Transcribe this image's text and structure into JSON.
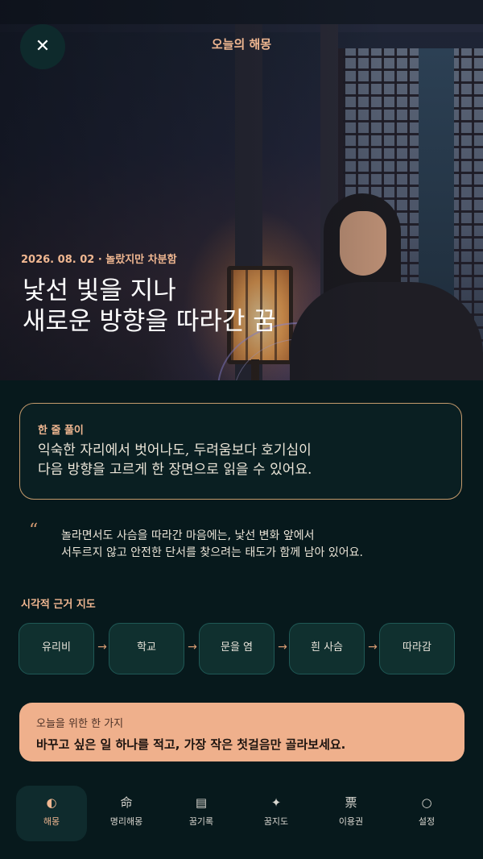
{
  "header": {
    "title": "오늘의 해몽",
    "close_label": "✕"
  },
  "hero": {
    "meta": "2026. 08. 02 · 놀랐지만 차분함",
    "title_lines": [
      "낯선 빛을 지나",
      "새로운 방향을 따라간 꿈"
    ]
  },
  "summary": {
    "label": "한 줄 풀이",
    "lines": [
      "익숙한 자리에서 벗어나도, 두려움보다 호기심이",
      "다음 방향을 고르게 한 장면으로 읽을 수 있어요."
    ]
  },
  "quote": {
    "mark": "“",
    "lines": [
      "놀라면서도 사슴을 따라간 마음에는, 낯선 변화 앞에서",
      "서두르지 않고 안전한 단서를 찾으려는 태도가 함께 남아 있어요."
    ]
  },
  "visual_map": {
    "title": "시각적 근거 지도",
    "nodes": [
      "유리비",
      "학교",
      "문을 염",
      "흰 사슴",
      "따라감"
    ],
    "arrow": "→"
  },
  "action": {
    "label": "오늘을 위한 한 가지",
    "text": "바꾸고 싶은 일 하나를 적고, 가장 작은 첫걸음만 골라보세요."
  },
  "nav": {
    "items": [
      {
        "label": "해몽",
        "icon": "◐",
        "icon_name": "half-moon-icon",
        "active": true
      },
      {
        "label": "명리해몽",
        "icon": "命",
        "icon_name": "fate-character-icon",
        "active": false
      },
      {
        "label": "꿈기록",
        "icon": "▤",
        "icon_name": "journal-icon",
        "active": false
      },
      {
        "label": "꿈지도",
        "icon": "✦",
        "icon_name": "sparkle-star-icon",
        "active": false
      },
      {
        "label": "이용권",
        "icon": "票",
        "icon_name": "ticket-character-icon",
        "active": false
      },
      {
        "label": "설정",
        "icon": "○",
        "icon_name": "circle-icon",
        "active": false
      }
    ]
  },
  "colors": {
    "background": "#07191c",
    "accent": "#f0b791",
    "action_card": "#efb08c",
    "node_fill": "#10302f",
    "node_border": "#1f5855",
    "summary_border": "#c49a6c"
  }
}
